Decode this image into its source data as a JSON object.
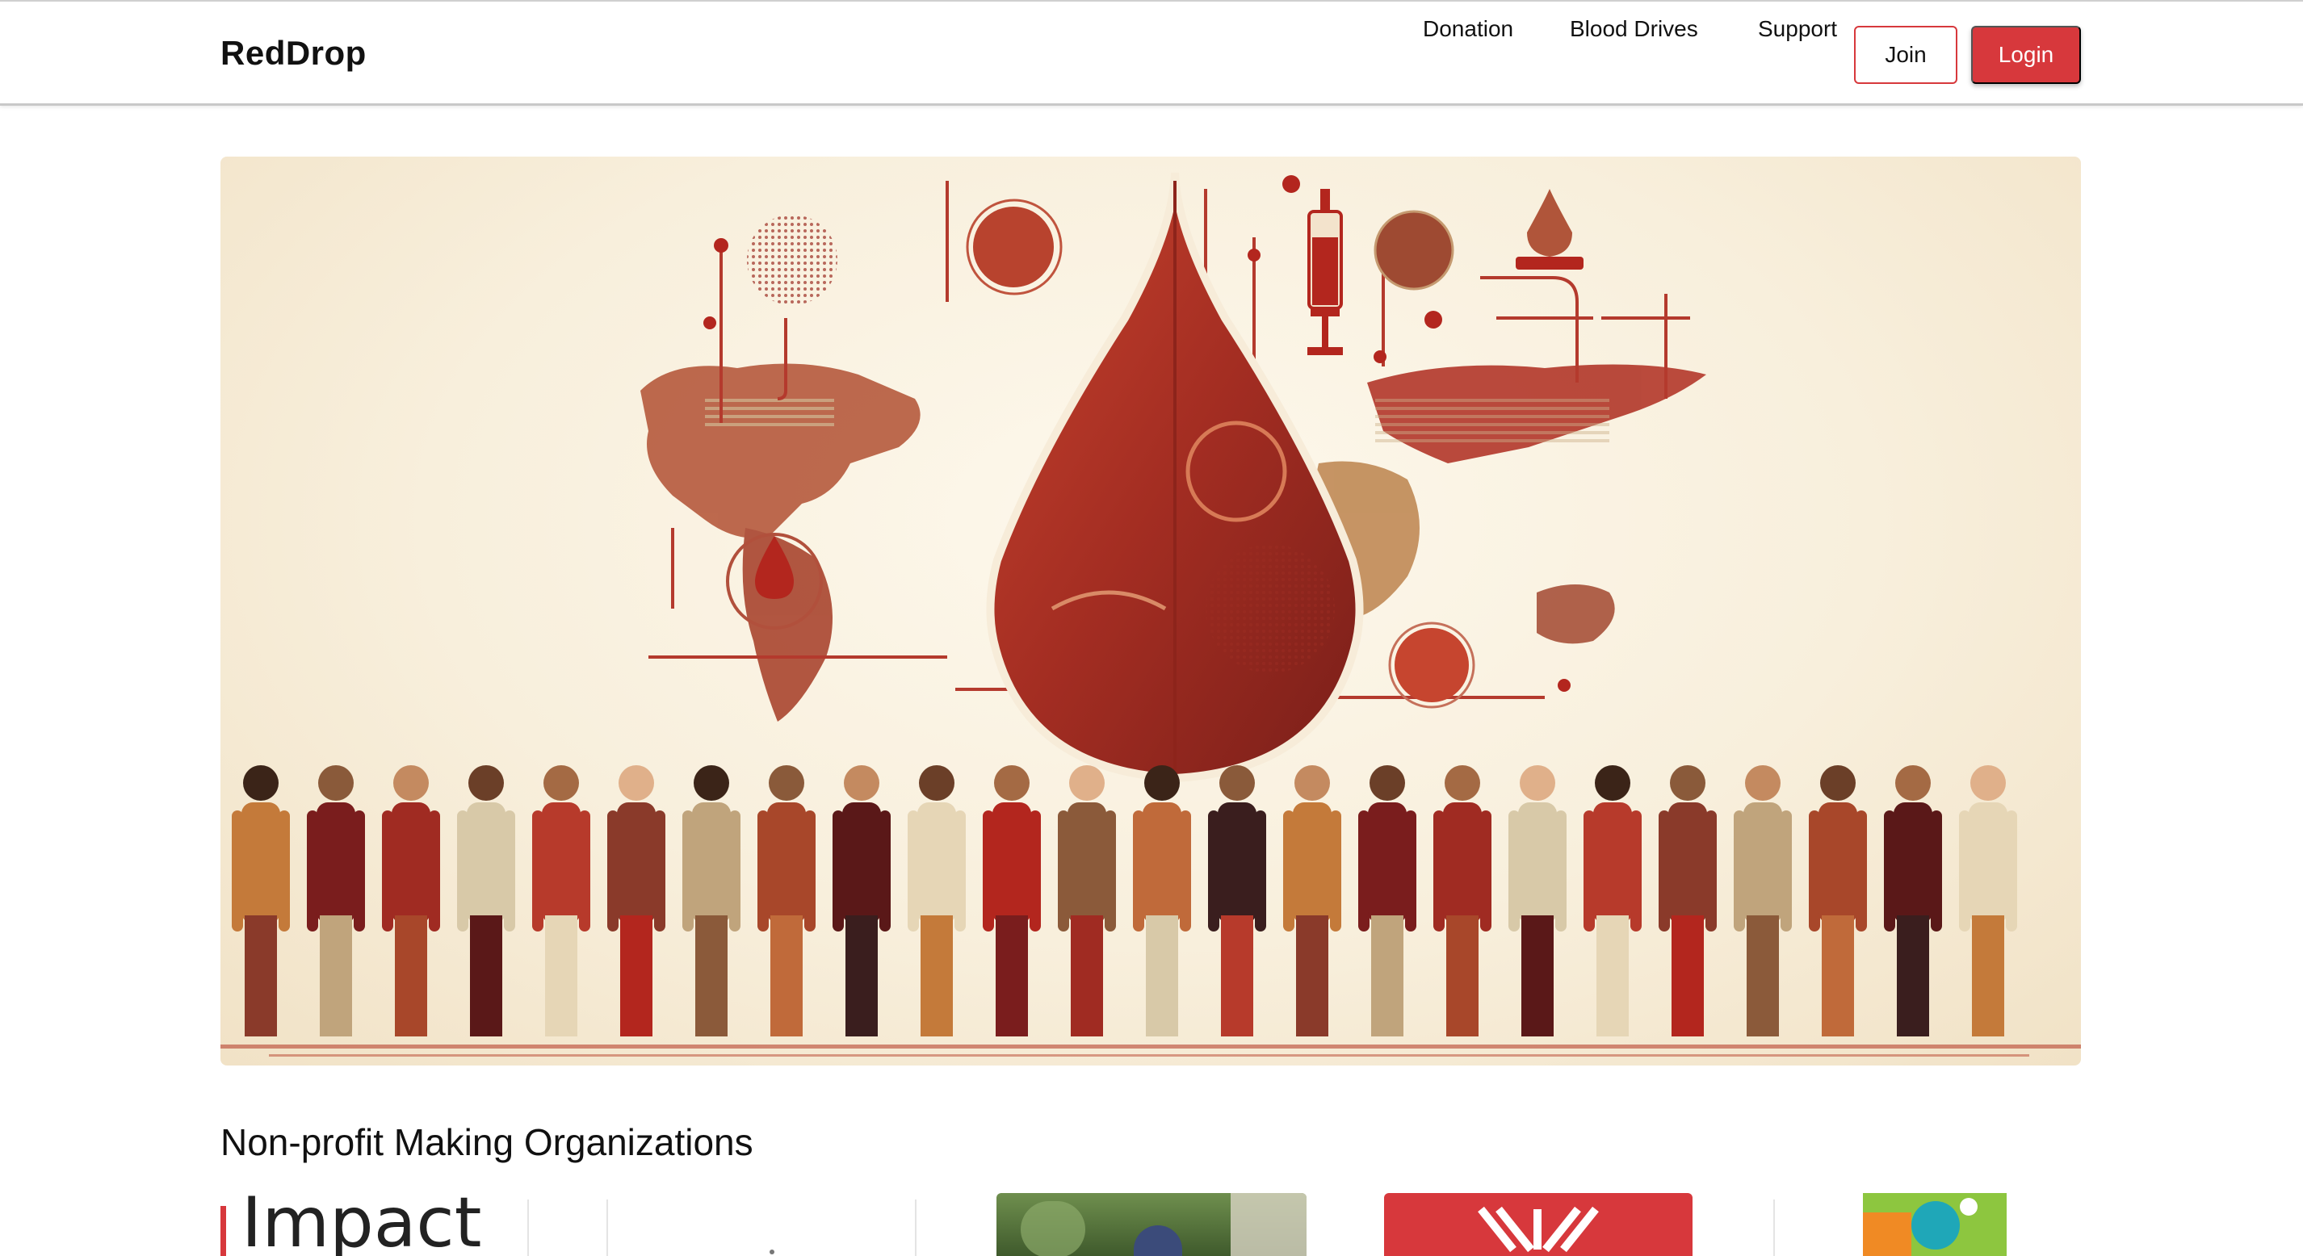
{
  "header": {
    "brand": "RedDrop",
    "nav": [
      {
        "label": "Donation"
      },
      {
        "label": "Blood Drives"
      },
      {
        "label": "Support"
      }
    ],
    "join_label": "Join",
    "login_label": "Login"
  },
  "section": {
    "title": "Non-profit Making Organizations"
  },
  "organizations": [
    {
      "logo_text": "Impact"
    }
  ],
  "colors": {
    "brand_red": "#d7383c",
    "hero_bg": "#f8efdc"
  },
  "icons": [
    "blood-drop-icon",
    "world-map-icon",
    "syringe-icon",
    "people-illustration"
  ]
}
